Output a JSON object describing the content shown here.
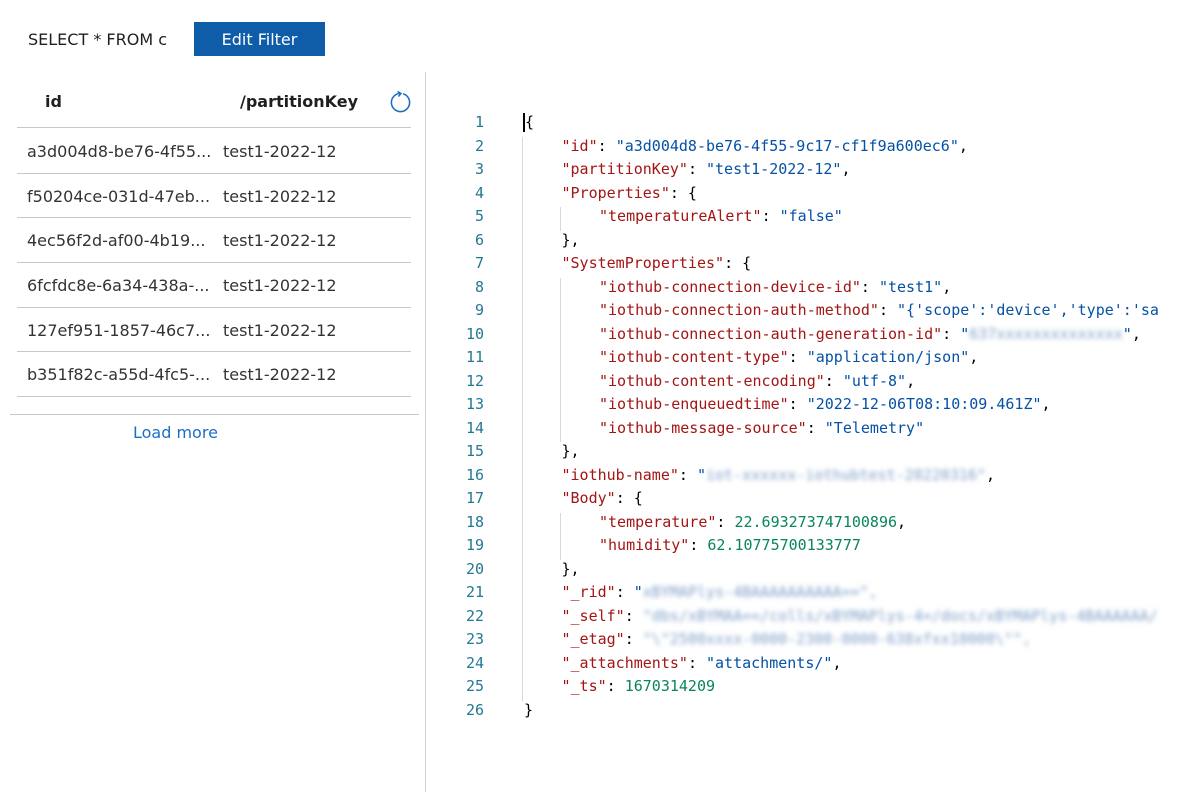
{
  "filter": {
    "query": "SELECT * FROM c",
    "edit_label": "Edit Filter"
  },
  "list": {
    "columns": {
      "id": "id",
      "partition_key": "/partitionKey"
    },
    "rows": [
      {
        "id": "a3d004d8-be76-4f55...",
        "partition_key": "test1-2022-12"
      },
      {
        "id": "f50204ce-031d-47eb...",
        "partition_key": "test1-2022-12"
      },
      {
        "id": "4ec56f2d-af00-4b19...",
        "partition_key": "test1-2022-12"
      },
      {
        "id": "6fcfdc8e-6a34-438a-...",
        "partition_key": "test1-2022-12"
      },
      {
        "id": "127ef951-1857-46c7...",
        "partition_key": "test1-2022-12"
      },
      {
        "id": "b351f82c-a55d-4fc5-...",
        "partition_key": "test1-2022-12"
      }
    ],
    "load_more": "Load more",
    "refresh_icon": "refresh-icon"
  },
  "editor": {
    "line_numbers": [
      "1",
      "2",
      "3",
      "4",
      "5",
      "6",
      "7",
      "8",
      "9",
      "10",
      "11",
      "12",
      "13",
      "14",
      "15",
      "16",
      "17",
      "18",
      "19",
      "20",
      "21",
      "22",
      "23",
      "24",
      "25",
      "26"
    ],
    "lines": [
      {
        "indent": 0,
        "tokens": [
          {
            "t": "p",
            "v": "{"
          }
        ]
      },
      {
        "indent": 1,
        "tokens": [
          {
            "t": "k",
            "v": "\"id\""
          },
          {
            "t": "p",
            "v": ": "
          },
          {
            "t": "s",
            "v": "\"a3d004d8-be76-4f55-9c17-cf1f9a600ec6\""
          },
          {
            "t": "p",
            "v": ","
          }
        ]
      },
      {
        "indent": 1,
        "tokens": [
          {
            "t": "k",
            "v": "\"partitionKey\""
          },
          {
            "t": "p",
            "v": ": "
          },
          {
            "t": "s",
            "v": "\"test1-2022-12\""
          },
          {
            "t": "p",
            "v": ","
          }
        ]
      },
      {
        "indent": 1,
        "tokens": [
          {
            "t": "k",
            "v": "\"Properties\""
          },
          {
            "t": "p",
            "v": ": {"
          }
        ]
      },
      {
        "indent": 2,
        "tokens": [
          {
            "t": "k",
            "v": "\"temperatureAlert\""
          },
          {
            "t": "p",
            "v": ": "
          },
          {
            "t": "s",
            "v": "\"false\""
          }
        ]
      },
      {
        "indent": 1,
        "tokens": [
          {
            "t": "p",
            "v": "},"
          }
        ]
      },
      {
        "indent": 1,
        "tokens": [
          {
            "t": "k",
            "v": "\"SystemProperties\""
          },
          {
            "t": "p",
            "v": ": {"
          }
        ]
      },
      {
        "indent": 2,
        "tokens": [
          {
            "t": "k",
            "v": "\"iothub-connection-device-id\""
          },
          {
            "t": "p",
            "v": ": "
          },
          {
            "t": "s",
            "v": "\"test1\""
          },
          {
            "t": "p",
            "v": ","
          }
        ]
      },
      {
        "indent": 2,
        "tokens": [
          {
            "t": "k",
            "v": "\"iothub-connection-auth-method\""
          },
          {
            "t": "p",
            "v": ": "
          },
          {
            "t": "s",
            "v": "\"{'scope':'device','type':'sa"
          }
        ]
      },
      {
        "indent": 2,
        "tokens": [
          {
            "t": "k",
            "v": "\"iothub-connection-auth-generation-id\""
          },
          {
            "t": "p",
            "v": ": "
          },
          {
            "t": "s",
            "v": "\""
          },
          {
            "t": "b",
            "v": "637xxxxxxxxxxxxxx"
          },
          {
            "t": "s",
            "v": "\""
          },
          {
            "t": "p",
            "v": ","
          }
        ]
      },
      {
        "indent": 2,
        "tokens": [
          {
            "t": "k",
            "v": "\"iothub-content-type\""
          },
          {
            "t": "p",
            "v": ": "
          },
          {
            "t": "s",
            "v": "\"application/json\""
          },
          {
            "t": "p",
            "v": ","
          }
        ]
      },
      {
        "indent": 2,
        "tokens": [
          {
            "t": "k",
            "v": "\"iothub-content-encoding\""
          },
          {
            "t": "p",
            "v": ": "
          },
          {
            "t": "s",
            "v": "\"utf-8\""
          },
          {
            "t": "p",
            "v": ","
          }
        ]
      },
      {
        "indent": 2,
        "tokens": [
          {
            "t": "k",
            "v": "\"iothub-enqueuedtime\""
          },
          {
            "t": "p",
            "v": ": "
          },
          {
            "t": "s",
            "v": "\"2022-12-06T08:10:09.461Z\""
          },
          {
            "t": "p",
            "v": ","
          }
        ]
      },
      {
        "indent": 2,
        "tokens": [
          {
            "t": "k",
            "v": "\"iothub-message-source\""
          },
          {
            "t": "p",
            "v": ": "
          },
          {
            "t": "s",
            "v": "\"Telemetry\""
          }
        ]
      },
      {
        "indent": 1,
        "tokens": [
          {
            "t": "p",
            "v": "},"
          }
        ]
      },
      {
        "indent": 1,
        "tokens": [
          {
            "t": "k",
            "v": "\"iothub-name\""
          },
          {
            "t": "p",
            "v": ": "
          },
          {
            "t": "s",
            "v": "\""
          },
          {
            "t": "b",
            "v": "iot-xxxxxx-iothubtest-20220316\""
          },
          {
            "t": "p",
            "v": ","
          }
        ]
      },
      {
        "indent": 1,
        "tokens": [
          {
            "t": "k",
            "v": "\"Body\""
          },
          {
            "t": "p",
            "v": ": {"
          }
        ]
      },
      {
        "indent": 2,
        "tokens": [
          {
            "t": "k",
            "v": "\"temperature\""
          },
          {
            "t": "p",
            "v": ": "
          },
          {
            "t": "n",
            "v": "22.693273747100896"
          },
          {
            "t": "p",
            "v": ","
          }
        ]
      },
      {
        "indent": 2,
        "tokens": [
          {
            "t": "k",
            "v": "\"humidity\""
          },
          {
            "t": "p",
            "v": ": "
          },
          {
            "t": "n",
            "v": "62.10775700133777"
          }
        ]
      },
      {
        "indent": 1,
        "tokens": [
          {
            "t": "p",
            "v": "},"
          }
        ]
      },
      {
        "indent": 1,
        "tokens": [
          {
            "t": "k",
            "v": "\"_rid\""
          },
          {
            "t": "p",
            "v": ": "
          },
          {
            "t": "s",
            "v": "\""
          },
          {
            "t": "b",
            "v": "xBYMAPlys-4BAAAAAAAAAA==\","
          }
        ]
      },
      {
        "indent": 1,
        "tokens": [
          {
            "t": "k",
            "v": "\"_self\""
          },
          {
            "t": "p",
            "v": ": "
          },
          {
            "t": "b",
            "v": "\"dbs/xBYMAA==/colls/xBYMAPlys-4=/docs/xBYMAPlys-4BAAAAAA/"
          }
        ]
      },
      {
        "indent": 1,
        "tokens": [
          {
            "t": "k",
            "v": "\"_etag\""
          },
          {
            "t": "p",
            "v": ": "
          },
          {
            "t": "b",
            "v": "\"\\\"2500xxxx-0000-2300-0000-638xfxx10000\\\"\","
          }
        ]
      },
      {
        "indent": 1,
        "tokens": [
          {
            "t": "k",
            "v": "\"_attachments\""
          },
          {
            "t": "p",
            "v": ": "
          },
          {
            "t": "s",
            "v": "\"attachments/\""
          },
          {
            "t": "p",
            "v": ","
          }
        ]
      },
      {
        "indent": 1,
        "tokens": [
          {
            "t": "k",
            "v": "\"_ts\""
          },
          {
            "t": "p",
            "v": ": "
          },
          {
            "t": "n",
            "v": "1670314209"
          }
        ]
      },
      {
        "indent": 0,
        "tokens": [
          {
            "t": "p",
            "v": "}"
          }
        ]
      }
    ]
  },
  "colors": {
    "button": "#0f5ca8",
    "link": "#1a6fc4",
    "json_key": "#a31515",
    "json_string": "#0451a5",
    "json_number": "#098658",
    "line_number": "#237893"
  }
}
